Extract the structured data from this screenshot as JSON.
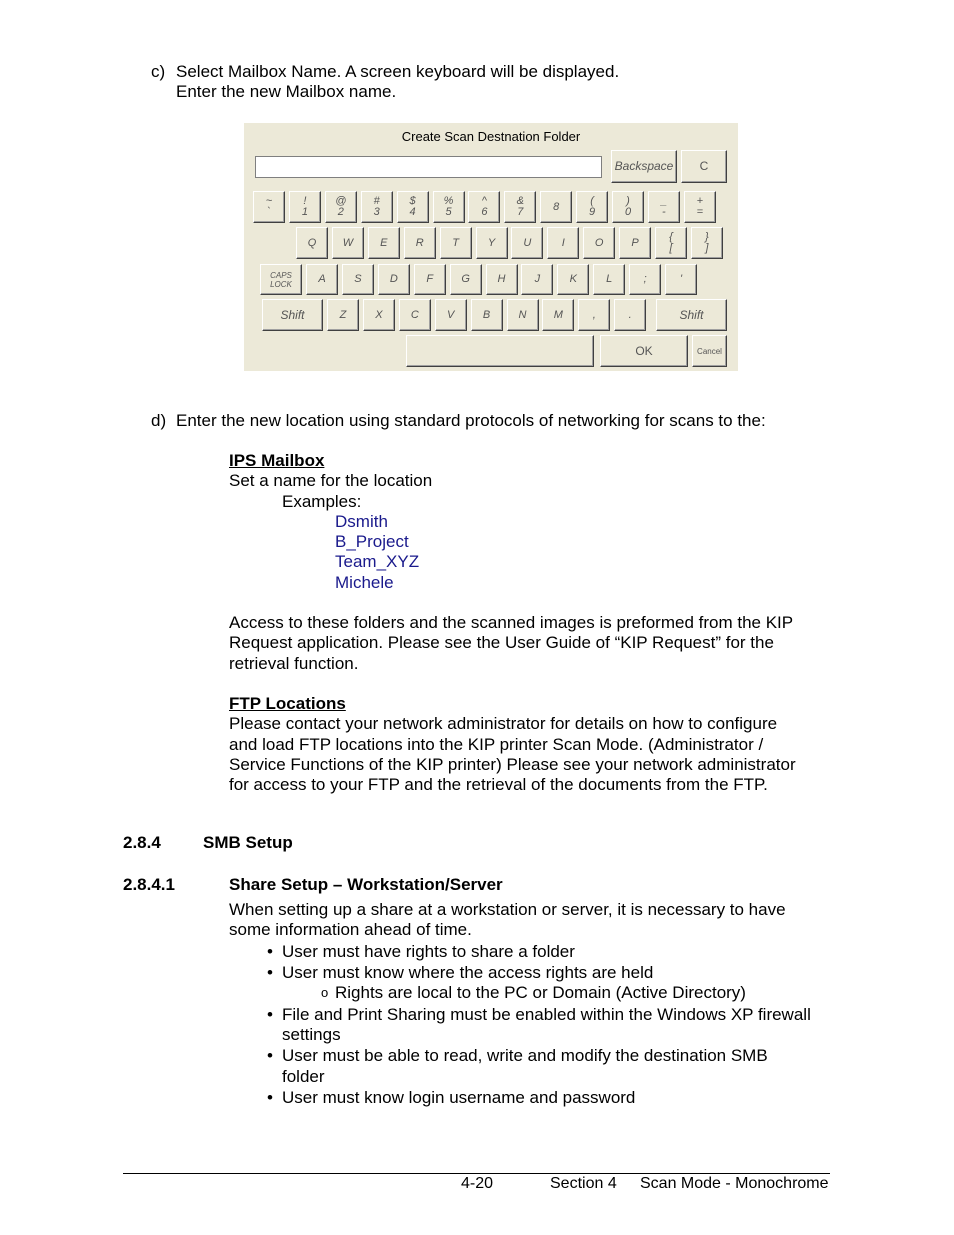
{
  "step_c": {
    "marker": "c)",
    "line1": "Select Mailbox Name. A screen keyboard will be displayed.",
    "line2": "Enter the new Mailbox name."
  },
  "keyboard": {
    "title": "Create Scan Destnation Folder",
    "input_value": "",
    "backspace": "Backspace",
    "clear": "C",
    "row1": [
      {
        "top": "~",
        "bot": "`"
      },
      {
        "top": "!",
        "bot": "1"
      },
      {
        "top": "@",
        "bot": "2"
      },
      {
        "top": "#",
        "bot": "3"
      },
      {
        "top": "$",
        "bot": "4"
      },
      {
        "top": "%",
        "bot": "5"
      },
      {
        "top": "^",
        "bot": "6"
      },
      {
        "top": "&",
        "bot": "7"
      },
      {
        "top": "",
        "bot": "8"
      },
      {
        "top": "(",
        "bot": "9"
      },
      {
        "top": ")",
        "bot": "0"
      },
      {
        "top": "_",
        "bot": "-"
      },
      {
        "top": "+",
        "bot": "="
      }
    ],
    "row2": [
      {
        "top": "Q",
        "bot": ""
      },
      {
        "top": "W",
        "bot": ""
      },
      {
        "top": "E",
        "bot": ""
      },
      {
        "top": "R",
        "bot": ""
      },
      {
        "top": "T",
        "bot": ""
      },
      {
        "top": "Y",
        "bot": ""
      },
      {
        "top": "U",
        "bot": ""
      },
      {
        "top": "I",
        "bot": ""
      },
      {
        "top": "O",
        "bot": ""
      },
      {
        "top": "P",
        "bot": ""
      },
      {
        "top": "{",
        "bot": "["
      },
      {
        "top": "}",
        "bot": "]"
      }
    ],
    "caps_lock": {
      "top": "CAPS",
      "bot": "LOCK"
    },
    "row3": [
      {
        "top": "A",
        "bot": ""
      },
      {
        "top": "S",
        "bot": ""
      },
      {
        "top": "D",
        "bot": ""
      },
      {
        "top": "F",
        "bot": ""
      },
      {
        "top": "G",
        "bot": ""
      },
      {
        "top": "H",
        "bot": ""
      },
      {
        "top": "J",
        "bot": ""
      },
      {
        "top": "K",
        "bot": ""
      },
      {
        "top": "L",
        "bot": ""
      },
      {
        "top": ";",
        "bot": ""
      },
      {
        "top": "'",
        "bot": ""
      }
    ],
    "shift_left": "Shift",
    "row4": [
      {
        "top": "Z",
        "bot": ""
      },
      {
        "top": "X",
        "bot": ""
      },
      {
        "top": "C",
        "bot": ""
      },
      {
        "top": "V",
        "bot": ""
      },
      {
        "top": "B",
        "bot": ""
      },
      {
        "top": "N",
        "bot": ""
      },
      {
        "top": "M",
        "bot": ""
      },
      {
        "top": ",",
        "bot": ""
      },
      {
        "top": ".",
        "bot": ""
      }
    ],
    "shift_right": "Shift",
    "space": "",
    "ok": "OK",
    "cancel": "Cancel"
  },
  "step_d": {
    "marker": "d)",
    "text": "Enter the new location using standard protocols of networking for scans to the:"
  },
  "ips": {
    "heading": "IPS Mailbox",
    "line": "Set a name for the location",
    "examples_label": "Examples:",
    "examples": [
      "Dsmith",
      "B_Project",
      "Team_XYZ",
      "Michele"
    ],
    "access_lines": [
      "Access to these folders and the scanned images is preformed from the KIP",
      "Request application. Please see the User Guide of “KIP Request” for the",
      "retrieval function."
    ]
  },
  "ftp": {
    "heading": "FTP Locations",
    "lines": [
      "Please contact your network administrator for details on how to configure",
      "and load FTP locations into the KIP printer Scan Mode. (Administrator /",
      "Service Functions of the KIP printer) Please see your network administrator",
      "for access to your FTP and the retrieval of the documents from the FTP."
    ]
  },
  "section_284": {
    "number": "2.8.4",
    "title": "SMB Setup"
  },
  "section_2841": {
    "number": "2.8.4.1",
    "title": "Share Setup – Workstation/Server",
    "intro_lines": [
      "When setting up a share at a workstation or server, it is necessary to have",
      "some information ahead of time."
    ],
    "bullets": [
      {
        "lines": [
          "User must have rights to share a folder"
        ]
      },
      {
        "lines": [
          "User must know where the access rights are held"
        ]
      },
      {
        "sub": true,
        "lines": [
          "Rights are local to the PC or Domain (Active Directory)"
        ]
      },
      {
        "lines": [
          "File and Print Sharing must be enabled within the Windows XP firewall",
          "settings"
        ]
      },
      {
        "lines": [
          "User must be able to read, write and modify the destination SMB",
          "folder"
        ]
      },
      {
        "lines": [
          "User must know login username and password"
        ]
      }
    ]
  },
  "footer": {
    "page": "4-20",
    "section": "Section 4",
    "title": "Scan Mode - Monochrome"
  }
}
